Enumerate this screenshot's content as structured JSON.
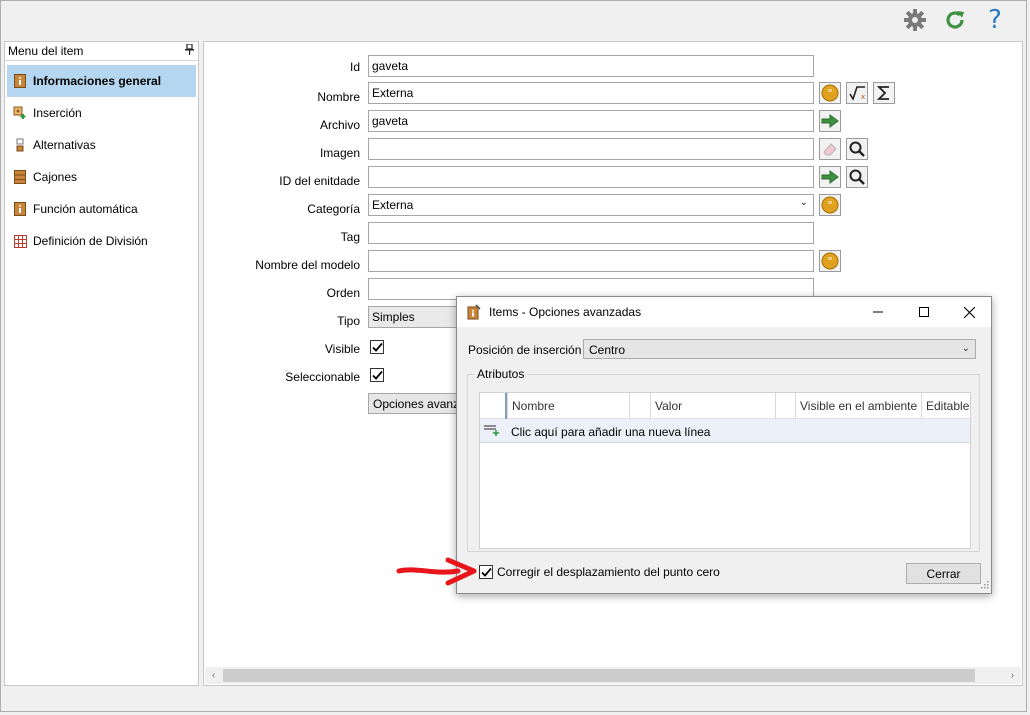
{
  "toolbar": {
    "icons": [
      "gear-icon",
      "refresh-icon",
      "help-icon"
    ],
    "accent_green": "#3f9142",
    "help_color": "#2a7bc4"
  },
  "sidebar": {
    "title": "Menu del item",
    "items": [
      {
        "label": "Informaciones general",
        "icon": "info-icon",
        "active": true
      },
      {
        "label": "Inserción",
        "icon": "insert-icon"
      },
      {
        "label": "Alternativas",
        "icon": "alternatives-icon"
      },
      {
        "label": "Cajones",
        "icon": "drawers-icon"
      },
      {
        "label": "Función automática",
        "icon": "auto-function-icon"
      },
      {
        "label": "Definición de División",
        "icon": "grid-icon"
      }
    ]
  },
  "form": {
    "labels": {
      "id": "Id",
      "nombre": "Nombre",
      "archivo": "Archivo",
      "imagen": "Imagen",
      "id_entidad": "ID del enitdade",
      "categoria": "Categoría",
      "tag": "Tag",
      "nombre_modelo": "Nombre del modelo",
      "orden": "Orden",
      "tipo": "Tipo",
      "visible": "Visible",
      "seleccionable": "Seleccionable"
    },
    "values": {
      "id": "gaveta",
      "nombre": "Externa",
      "archivo": "gaveta",
      "imagen": "",
      "id_entidad": "",
      "categoria": "Externa",
      "tag": "",
      "nombre_modelo": "",
      "orden": "",
      "tipo": "Simples"
    },
    "visible_checked": true,
    "seleccionable_checked": true,
    "options_button": "Opciones avanzadas"
  },
  "dialog": {
    "title": "Items - Opciones avanzadas",
    "position_label": "Posición de inserción",
    "position_value": "Centro",
    "group_title": "Atributos",
    "columns": [
      "Nombre",
      "Valor",
      "Visible en el ambiente",
      "Editable"
    ],
    "new_row_hint": "Clic aquí para añadir una nueva línea",
    "checkbox_label": "Corregir el desplazamiento del punto cero",
    "checkbox_checked": true,
    "close_button": "Cerrar"
  }
}
